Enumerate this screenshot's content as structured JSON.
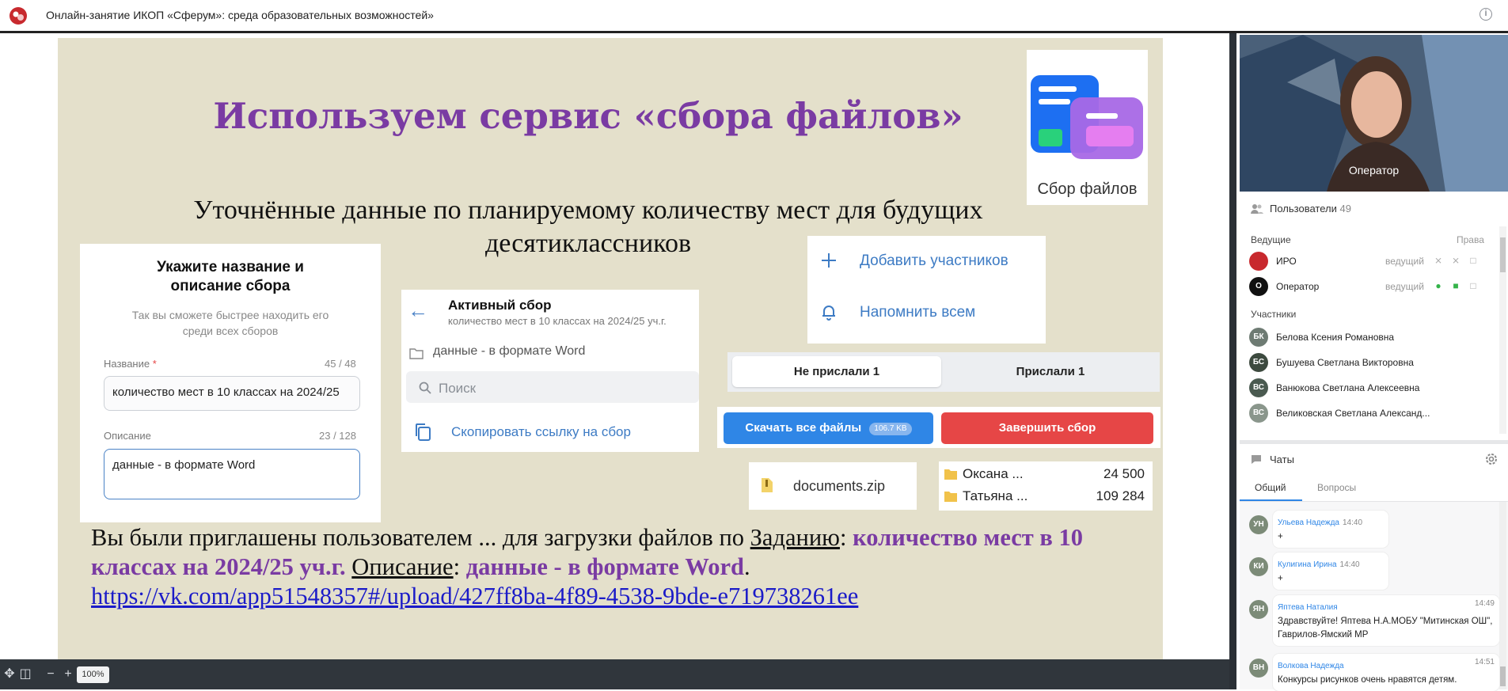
{
  "window": {
    "title": "Онлайн-занятие ИКОП «Сферум»: среда образовательных возможностей»",
    "info_icon": "i"
  },
  "slide": {
    "title": "Используем сервис «сбора файлов»",
    "subtitle_line1": "Уточнённые данные по планируемому количеству мест для будущих",
    "subtitle_line2": "десятиклассников",
    "logo_caption": "Сбор файлов",
    "form": {
      "title_line1": "Укажите название и",
      "title_line2": "описание сбора",
      "hint_line1": "Так вы сможете быстрее находить его",
      "hint_line2": "среди всех сборов",
      "name_label": "Название",
      "name_required": "*",
      "name_counter": "45 / 48",
      "name_value": "количество мест в 10 классах на 2024/25",
      "desc_label": "Описание",
      "desc_counter": "23 / 128",
      "desc_value": "данные - в формате Word"
    },
    "active": {
      "title": "Активный сбор",
      "subtitle": "количество мест в 10 классах на 2024/25 уч.г.",
      "folder_row": "данные - в формате Word",
      "search_placeholder": "Поиск",
      "copy_link": "Скопировать ссылку на сбор"
    },
    "actions": {
      "add_participants": "Добавить участников",
      "remind_all": "Напомнить всем"
    },
    "tabs": {
      "not_sent": "Не прислали 1",
      "sent": "Прислали 1"
    },
    "buttons": {
      "download_all": "Скачать все файлы",
      "download_size": "106.7 KB",
      "finish": "Завершить сбор"
    },
    "zip_file": "documents.zip",
    "files": [
      {
        "name": "Оксана ...",
        "amount": "24 500"
      },
      {
        "name": "Татьяна ...",
        "amount": "109 284"
      }
    ],
    "paragraph": {
      "p1": "Вы были приглашены пользователем ... для загрузки файлов по ",
      "u1": "Заданию",
      "p2": ": ",
      "b1": "количество мест в 10 классах на 2024/25 уч.г.",
      "p3": " ",
      "u2": "Описание",
      "p4": ": ",
      "b2": "данные - в формате Word",
      "p5": ".",
      "link": "https://vk.com/app51548357#/upload/427ff8ba-4f89-4538-9bde-e719738261ee"
    }
  },
  "toolbar": {
    "zoom": "100%",
    "zoom_out": "−",
    "zoom_in": "+"
  },
  "video": {
    "name": "Оператор"
  },
  "users": {
    "header": "Пользователи",
    "count": "49",
    "hosts_label": "Ведущие",
    "rights_label": "Права",
    "hosts": [
      {
        "initials": "",
        "name": "ИРО",
        "role": "ведущий"
      },
      {
        "initials": "О",
        "name": "Оператор",
        "role": "ведущий"
      }
    ],
    "participants_label": "Участники",
    "participants": [
      {
        "initials": "БК",
        "name": "Белова Ксения Романовна"
      },
      {
        "initials": "БС",
        "name": "Бушуева Светлана Викторовна"
      },
      {
        "initials": "ВС",
        "name": "Ванюкова Светлана Алексеевна"
      },
      {
        "initials": "ВС",
        "name": "Великовская Светлана Александ..."
      }
    ]
  },
  "chats": {
    "header": "Чаты",
    "tab_general": "Общий",
    "tab_questions": "Вопросы",
    "messages": [
      {
        "initials": "УН",
        "author": "Ульева Надежда",
        "time": "14:40",
        "text": "+"
      },
      {
        "initials": "КИ",
        "author": "Кулигина Ирина",
        "time": "14:40",
        "text": "+"
      },
      {
        "initials": "ЯН",
        "author": "Яптева Наталия",
        "time": "14:49",
        "text": "Здравствуйте! Яптева Н.А.МОБУ \"Митинская ОШ\", Гаврилов-Ямский МР"
      },
      {
        "initials": "ВН",
        "author": "Волкова Надежда",
        "time": "14:51",
        "text": "Конкурсы рисунков очень нравятся детям."
      }
    ]
  },
  "colors": {
    "slide_bg": "#e4e0cb",
    "title_purple": "#7a3ba3",
    "link_blue": "#1b1bc8",
    "accent_blue": "#2f86e6",
    "danger_red": "#e64646"
  }
}
